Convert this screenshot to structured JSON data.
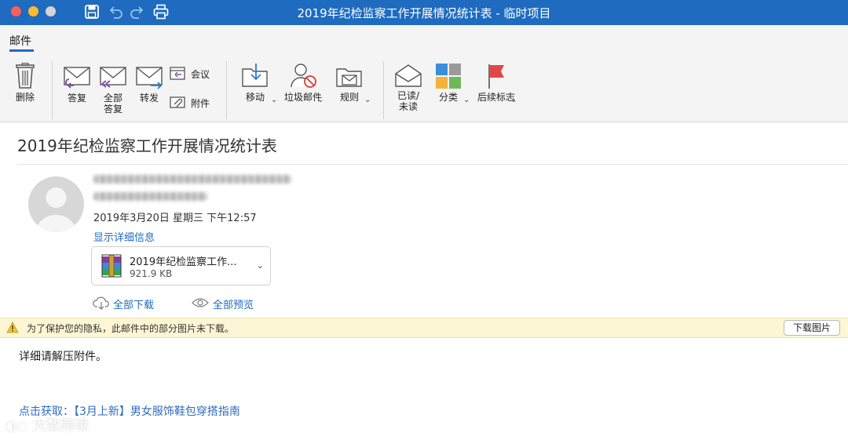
{
  "window": {
    "title": "2019年纪检监察工作开展情况统计表 - 临时项目"
  },
  "ribbon": {
    "tab_label": "邮件",
    "buttons": {
      "delete": "删除",
      "reply": "答复",
      "reply_all_line1": "全部",
      "reply_all_line2": "答复",
      "forward": "转发",
      "meeting": "会议",
      "attachment": "附件",
      "move": "移动",
      "junk": "垃圾邮件",
      "rules": "规则",
      "read_unread_line1": "已读/",
      "read_unread_line2": "未读",
      "categorize": "分类",
      "follow_up": "后续标志"
    }
  },
  "message": {
    "subject": "2019年纪检监察工作开展情况统计表",
    "date": "2019年3月20日 星期三 下午12:57",
    "show_details": "显示详细信息",
    "attachment": {
      "name": "2019年纪检监察工作...",
      "size": "921.9 KB"
    },
    "download_all": "全部下载",
    "preview_all": "全部预览",
    "privacy_notice": "为了保护您的隐私，此邮件中的部分图片未下载。",
    "download_images": "下载图片",
    "body": "详细请解压附件。",
    "promo_link": "点击获取：【3月上新】男女服饰鞋包穿搭指南"
  },
  "watermark": "大数跨境",
  "colors": {
    "titlebar": "#1e6bbf",
    "accent": "#1e6bbf",
    "privacy_bar": "#fdf6d4",
    "flag": "#e04848"
  }
}
